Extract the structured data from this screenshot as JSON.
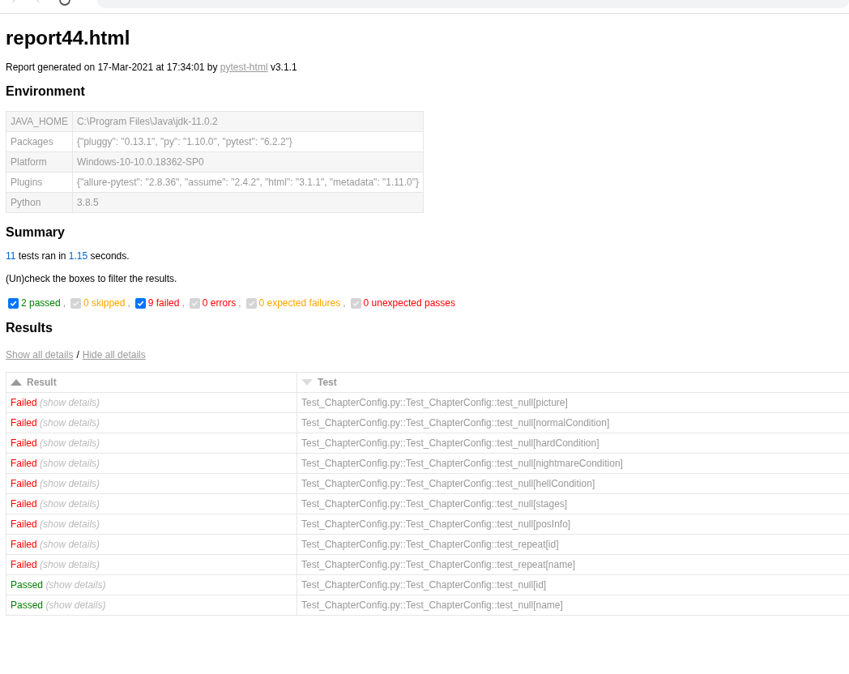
{
  "title": "report44.html",
  "generated": {
    "before": "Report generated on 17-Mar-2021 at 17:34:01 by",
    "link": "pytest-html",
    "after": "v3.1.1"
  },
  "environment": {
    "heading": "Environment",
    "rows": [
      {
        "key": "JAVA_HOME",
        "value": "C:\\Program Files\\Java\\jdk-11.0.2"
      },
      {
        "key": "Packages",
        "value": "{\"pluggy\": \"0.13.1\", \"py\": \"1.10.0\", \"pytest\": \"6.2.2\"}"
      },
      {
        "key": "Platform",
        "value": "Windows-10-10.0.18362-SP0"
      },
      {
        "key": "Plugins",
        "value": "{\"allure-pytest\": \"2.8.36\", \"assume\": \"2.4.2\", \"html\": \"3.1.1\", \"metadata\": \"1.11.0\"}"
      },
      {
        "key": "Python",
        "value": "3.8.5"
      }
    ]
  },
  "summary": {
    "heading": "Summary",
    "count": "11",
    "ran_text": "tests ran in",
    "duration": "1.15",
    "seconds_text": "seconds.",
    "hint": "(Un)check the boxes to filter the results.",
    "filter_separator": ",",
    "filters": [
      {
        "kind": "passed",
        "label": "2 passed",
        "checked": true,
        "disabled": false
      },
      {
        "kind": "skipped",
        "label": "0 skipped",
        "checked": true,
        "disabled": true
      },
      {
        "kind": "failed",
        "label": "9 failed",
        "checked": true,
        "disabled": false
      },
      {
        "kind": "error",
        "label": "0 errors",
        "checked": true,
        "disabled": true
      },
      {
        "kind": "xfailed",
        "label": "0 expected failures",
        "checked": true,
        "disabled": true
      },
      {
        "kind": "xpassed",
        "label": "0 unexpected passes",
        "checked": true,
        "disabled": true
      }
    ]
  },
  "results": {
    "heading": "Results",
    "show_all": "Show all details",
    "separator": "/",
    "hide_all": "Hide all details",
    "columns": [
      {
        "label": "Result",
        "ascending": true,
        "active": true
      },
      {
        "label": "Test",
        "ascending": false,
        "active": false
      }
    ],
    "rows": [
      {
        "kind": "failed",
        "result": "Failed",
        "details": "(show details)",
        "test": "Test_ChapterConfig.py::Test_ChapterConfig::test_null[picture]"
      },
      {
        "kind": "failed",
        "result": "Failed",
        "details": "(show details)",
        "test": "Test_ChapterConfig.py::Test_ChapterConfig::test_null[normalCondition]"
      },
      {
        "kind": "failed",
        "result": "Failed",
        "details": "(show details)",
        "test": "Test_ChapterConfig.py::Test_ChapterConfig::test_null[hardCondition]"
      },
      {
        "kind": "failed",
        "result": "Failed",
        "details": "(show details)",
        "test": "Test_ChapterConfig.py::Test_ChapterConfig::test_null[nightmareCondition]"
      },
      {
        "kind": "failed",
        "result": "Failed",
        "details": "(show details)",
        "test": "Test_ChapterConfig.py::Test_ChapterConfig::test_null[hellCondition]"
      },
      {
        "kind": "failed",
        "result": "Failed",
        "details": "(show details)",
        "test": "Test_ChapterConfig.py::Test_ChapterConfig::test_null[stages]"
      },
      {
        "kind": "failed",
        "result": "Failed",
        "details": "(show details)",
        "test": "Test_ChapterConfig.py::Test_ChapterConfig::test_null[posInfo]"
      },
      {
        "kind": "failed",
        "result": "Failed",
        "details": "(show details)",
        "test": "Test_ChapterConfig.py::Test_ChapterConfig::test_repeat[id]"
      },
      {
        "kind": "failed",
        "result": "Failed",
        "details": "(show details)",
        "test": "Test_ChapterConfig.py::Test_ChapterConfig::test_repeat[name]"
      },
      {
        "kind": "passed",
        "result": "Passed",
        "details": "(show details)",
        "test": "Test_ChapterConfig.py::Test_ChapterConfig::test_null[id]"
      },
      {
        "kind": "passed",
        "result": "Passed",
        "details": "(show details)",
        "test": "Test_ChapterConfig.py::Test_ChapterConfig::test_null[name]"
      }
    ]
  }
}
